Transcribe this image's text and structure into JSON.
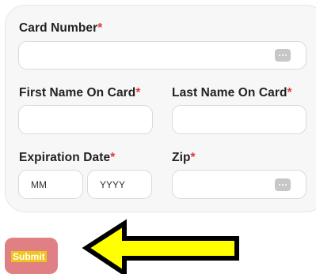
{
  "form": {
    "card_number_label": "Card Number",
    "first_name_label": "First Name On Card",
    "last_name_label": "Last Name On Card",
    "expiration_label": "Expiration Date",
    "zip_label": "Zip",
    "required_marker": "*",
    "card_number_value": "",
    "first_name_value": "",
    "last_name_value": "",
    "exp_month_value": "MM",
    "exp_year_value": "YYYY",
    "zip_value": ""
  },
  "submit": {
    "label": "Submit"
  },
  "colors": {
    "required": "#e03a3a",
    "submit_bg": "#e07f84",
    "submit_highlight": "#f0c419",
    "arrow_fill": "#ffff00"
  },
  "icons": {
    "field_icon": "more-dots-icon",
    "annotation": "arrow-left-icon"
  }
}
